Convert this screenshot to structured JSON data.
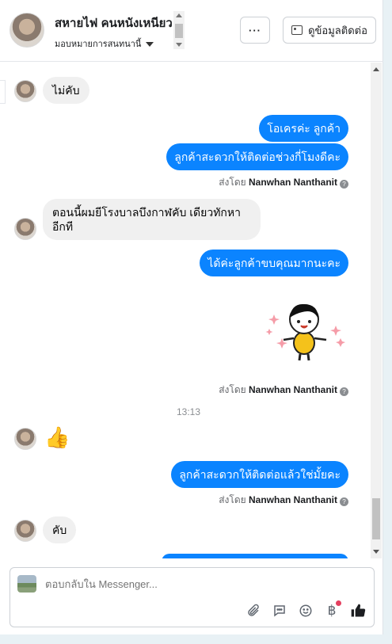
{
  "header": {
    "contact_name": "สหายไฟ คนหนังเหนียว",
    "assign_label": "มอบหมายการสนทนานี้",
    "more_label": "···",
    "contact_info_label": "ดูข้อมูลติดต่อ"
  },
  "messages": {
    "m1": "ไม่คับ",
    "m2": "โอเครค่ะ ลูกค้า",
    "m3": "ลูกค้าสะดวกให้ติดต่อช่วงกี่โมงดีคะ",
    "sent1_prefix": "ส่งโดย",
    "sent1_name": "Nanwhan Nanthanit",
    "m4": "ตอนนี้ผมยีโรงบาลบึงกาฬคับ เดียวทักหาอีกที",
    "m5": "ได้ค่ะลูกค้าขบคุณมากนะคะ",
    "sent2_prefix": "ส่งโดย",
    "sent2_name": "Nanwhan Nanthanit",
    "time": "13:13",
    "m6": "👍",
    "m7": "ลูกค้าสะดวกให้ติดต่อแล้วใช่มั้ยคะ",
    "sent3_prefix": "ส่งโดย",
    "sent3_name": "Nanwhan Nanthanit",
    "m8": "คับ"
  },
  "composer": {
    "placeholder": "ตอบกลับใน Messenger..."
  },
  "icons": {
    "attach": "paperclip-icon",
    "saved_reply": "chat-bubble-icon",
    "emoji": "smiley-icon",
    "payment": "baht-icon",
    "like": "thumbs-up-icon"
  },
  "colors": {
    "outgoing_bubble": "#0b84ff",
    "incoming_bubble": "#f0f0f0",
    "notification_dot": "#e4405f"
  }
}
